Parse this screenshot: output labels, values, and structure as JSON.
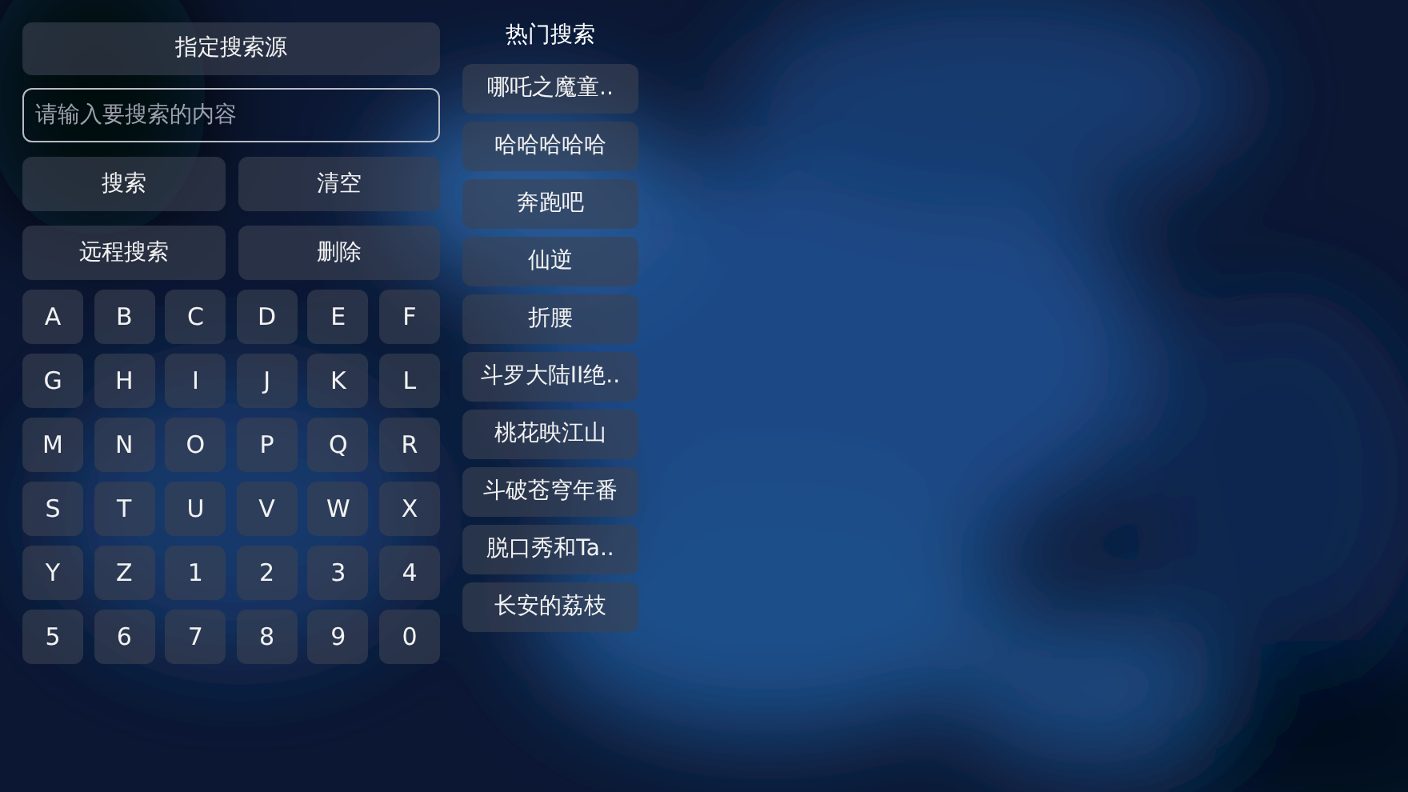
{
  "source_button": "指定搜索源",
  "search_field": {
    "placeholder": "请输入要搜索的内容"
  },
  "action_buttons": [
    "搜索",
    "清空",
    "远程搜索",
    "删除"
  ],
  "keys": [
    "A",
    "B",
    "C",
    "D",
    "E",
    "F",
    "G",
    "H",
    "I",
    "J",
    "K",
    "L",
    "M",
    "N",
    "O",
    "P",
    "Q",
    "R",
    "S",
    "T",
    "U",
    "V",
    "W",
    "X",
    "Y",
    "Z",
    "1",
    "2",
    "3",
    "4",
    "5",
    "6",
    "7",
    "8",
    "9",
    "0"
  ],
  "hot_search": {
    "title": "热门搜索",
    "items": [
      "哪吒之魔童..",
      "哈哈哈哈哈",
      "奔跑吧",
      "仙逆",
      "折腰",
      "斗罗大陆II绝..",
      "桃花映江山",
      "斗破苍穹年番",
      "脱口秀和Ta..",
      "长安的荔枝"
    ]
  }
}
